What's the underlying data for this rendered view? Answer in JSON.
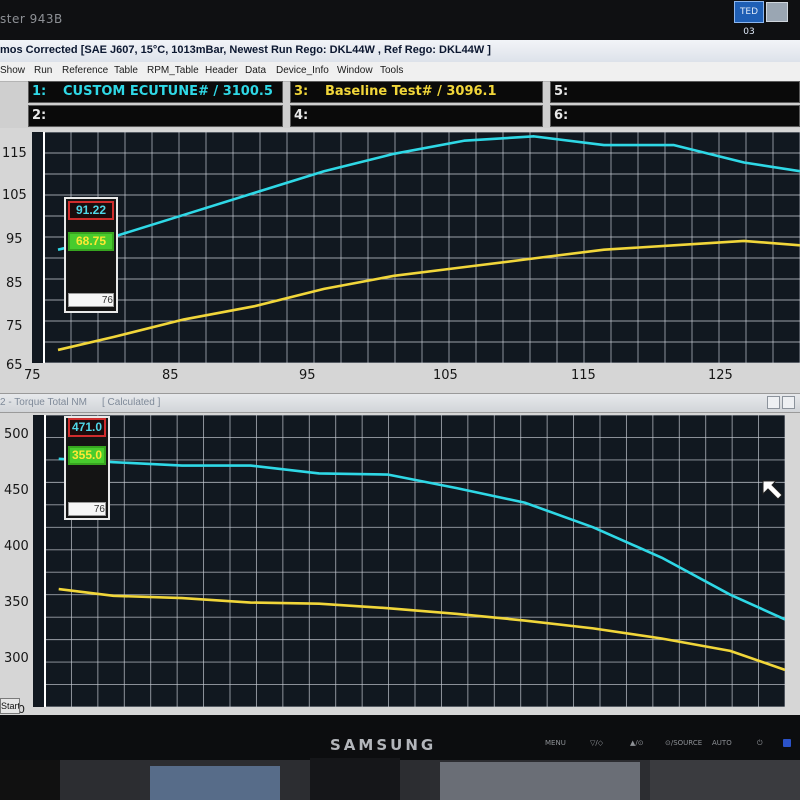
{
  "bezel": {
    "title": "ster 943B",
    "brand": "SAMSUNG",
    "tray_label": "TED 03",
    "buttons": [
      "MENU",
      "▽/◇",
      "▲/⊙",
      "⊙/SOURCE",
      "AUTO",
      "⏻"
    ]
  },
  "window": {
    "title": "mos Corrected [SAE J607, 15°C, 1013mBar,  Newest Run Rego: DKL44W ,  Ref Rego: DKL44W ]",
    "menu": [
      "Show",
      "Run",
      "Reference",
      "Table",
      "RPM_Table",
      "Header",
      "Data",
      "Device_Info",
      "Window",
      "Tools"
    ]
  },
  "runs": [
    {
      "slot": "1:",
      "label": "CUSTOM ECUTUNE# / 3100.5",
      "color": "#2fd8e6"
    },
    {
      "slot": "3:",
      "label": "Baseline Test# / 3096.1",
      "color": "#f1d63a"
    },
    {
      "slot": "5:",
      "label": ""
    },
    {
      "slot": "2:",
      "label": ""
    },
    {
      "slot": "4:",
      "label": ""
    },
    {
      "slot": "6:",
      "label": ""
    }
  ],
  "top_chart": {
    "cursor": {
      "a": "91.22",
      "b": "68.75",
      "c": "76"
    },
    "x_ticks": [
      "75",
      "85",
      "95",
      "105",
      "115",
      "125"
    ],
    "y_ticks": [
      "115",
      "105",
      "95",
      "85",
      "75",
      "65"
    ]
  },
  "bottom_chart": {
    "title": "2 - Torque Total NM",
    "subtitle": "[ Calculated ]",
    "cursor": {
      "a": "471.0",
      "b": "355.0",
      "c": "76"
    },
    "y_ticks": [
      "500",
      "450",
      "400",
      "350",
      "300",
      "250"
    ]
  },
  "start_label": "Start",
  "chart_data": [
    {
      "type": "line",
      "x": [
        76,
        80,
        85,
        90,
        95,
        100,
        105,
        110,
        115,
        120,
        125,
        129
      ],
      "xlim": [
        75,
        129
      ],
      "ylim": [
        65,
        118
      ],
      "series": [
        {
          "name": "CUSTOM ECUTUNE# / 3100.5",
          "color": "#2fd8e6",
          "values": [
            91,
            94,
            99,
            104,
            109,
            113,
            116,
            117,
            115,
            115,
            111,
            109
          ]
        },
        {
          "name": "Baseline Test# / 3096.1",
          "color": "#f1d63a",
          "values": [
            68,
            71,
            75,
            78,
            82,
            85,
            87,
            89,
            91,
            92,
            93,
            92
          ]
        }
      ]
    },
    {
      "type": "line",
      "x": [
        76,
        80,
        85,
        90,
        95,
        100,
        105,
        110,
        115,
        120,
        125,
        129
      ],
      "xlim": [
        75,
        129
      ],
      "ylim": [
        250,
        510
      ],
      "series": [
        {
          "name": "CUSTOM ECUTUNE# / 3100.5",
          "color": "#2fd8e6",
          "values": [
            471,
            468,
            465,
            465,
            458,
            457,
            445,
            432,
            410,
            383,
            350,
            328
          ]
        },
        {
          "name": "Baseline Test# / 3096.1",
          "color": "#f1d63a",
          "values": [
            355,
            349,
            347,
            343,
            342,
            338,
            333,
            327,
            320,
            311,
            300,
            283
          ]
        }
      ]
    }
  ]
}
